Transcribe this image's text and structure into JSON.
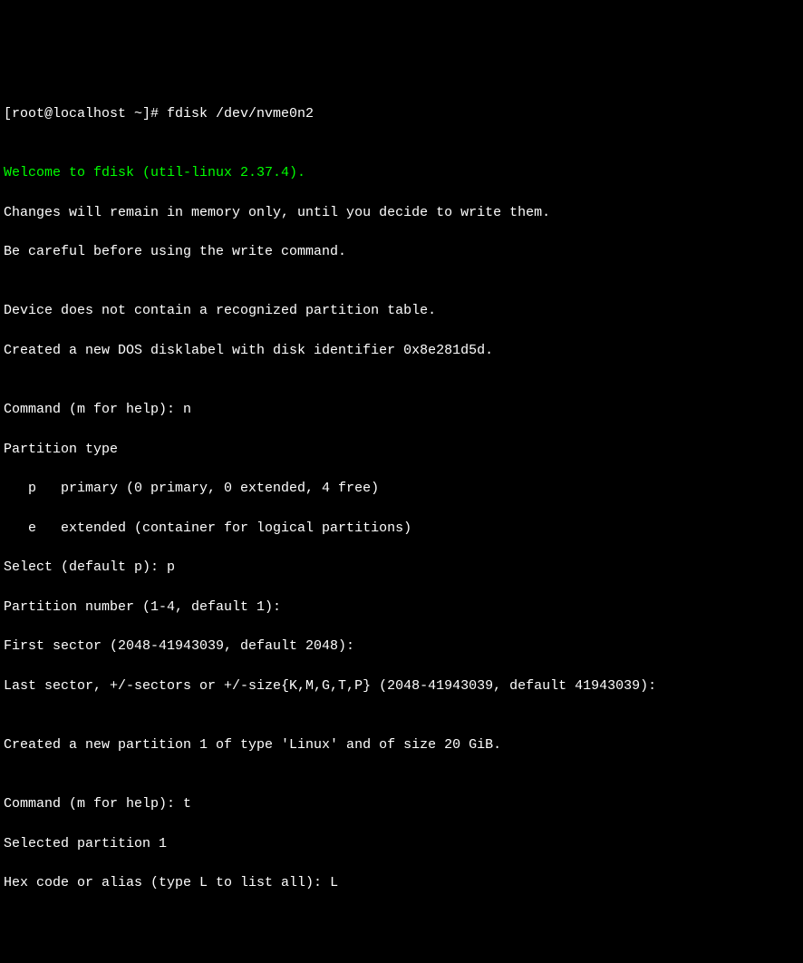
{
  "prompt": "[root@localhost ~]# ",
  "command": "fdisk /dev/nvme0n2",
  "blank1": "",
  "welcome": "Welcome to fdisk (util-linux 2.37.4).",
  "changes_warning": "Changes will remain in memory only, until you decide to write them.",
  "careful_warning": "Be careful before using the write command.",
  "blank2": "",
  "no_table": "Device does not contain a recognized partition table.",
  "created_dos": "Created a new DOS disklabel with disk identifier 0x8e281d5d.",
  "blank3": "",
  "cmd_prompt1": "Command (m for help): ",
  "cmd_input1": "n",
  "partition_type_header": "Partition type",
  "p_option": "   p   primary (0 primary, 0 extended, 4 free)",
  "e_option": "   e   extended (container for logical partitions)",
  "select_prompt": "Select (default p): ",
  "select_input": "p",
  "partition_number_prompt": "Partition number (1-4, default 1):",
  "first_sector_prompt": "First sector (2048-41943039, default 2048):",
  "last_sector_prompt": "Last sector, +/-sectors or +/-size{K,M,G,T,P} (2048-41943039, default 41943039):",
  "blank4": "",
  "created_partition": "Created a new partition 1 of type 'Linux' and of size 20 GiB.",
  "blank5": "",
  "cmd_prompt2": "Command (m for help): ",
  "cmd_input2": "t",
  "selected_partition": "Selected partition 1",
  "hex_prompt": "Hex code or alias (type L to list all): ",
  "hex_input": "L"
}
